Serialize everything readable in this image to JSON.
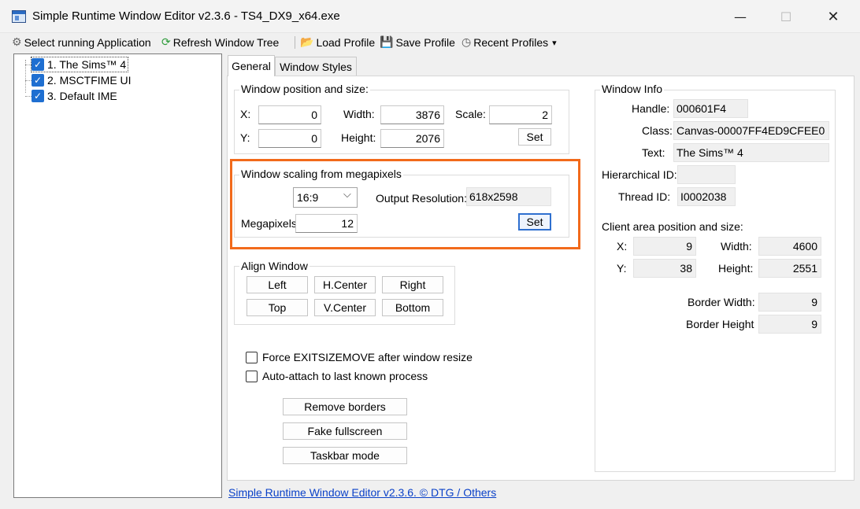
{
  "window": {
    "title": "Simple Runtime Window Editor v2.3.6 - TS4_DX9_x64.exe",
    "minimize": "—",
    "maximize": "☐",
    "close": "✕"
  },
  "toolbar": {
    "select_app": "Select running Application",
    "refresh_tree": "Refresh Window Tree",
    "load_profile": "Load Profile",
    "save_profile": "Save Profile",
    "recent_profiles": "Recent Profiles",
    "recent_arrow": "▾"
  },
  "tree": {
    "items": [
      {
        "label": "1. The Sims™ 4",
        "checked": true
      },
      {
        "label": "2. MSCTFIME UI",
        "checked": true
      },
      {
        "label": "3. Default IME",
        "checked": true
      }
    ],
    "check_glyph": "✓"
  },
  "tabs": {
    "general": "General",
    "window_styles": "Window Styles"
  },
  "position_group": {
    "title": "Window position and size:",
    "x_label": "X:",
    "x_value": "0",
    "y_label": "Y:",
    "y_value": "0",
    "width_label": "Width:",
    "width_value": "3876",
    "height_label": "Height:",
    "height_value": "2076",
    "scale_label": "Scale:",
    "scale_value": "2",
    "set_label": "Set"
  },
  "megapixel_group": {
    "title": "Window scaling from megapixels",
    "aspect_value": "16:9",
    "dropdown_glyph": "⌵",
    "output_label": "Output Resolution:",
    "output_value": "618x2598",
    "megapixels_label": "Megapixels",
    "megapixels_value": "12",
    "set_label": "Set"
  },
  "align_group": {
    "title": "Align Window",
    "left": "Left",
    "hcenter": "H.Center",
    "right": "Right",
    "top": "Top",
    "vcenter": "V.Center",
    "bottom": "Bottom"
  },
  "options": {
    "force_exitsizemove": "Force EXITSIZEMOVE after window resize",
    "auto_attach": "Auto-attach to last known process"
  },
  "actions": {
    "remove_borders": "Remove borders",
    "fake_fullscreen": "Fake fullscreen",
    "taskbar_mode": "Taskbar mode"
  },
  "window_info": {
    "title": "Window Info",
    "handle_label": "Handle:",
    "handle_value": "000601F4",
    "class_label": "Class:",
    "class_value": "Canvas-00007FF4ED9CFEE0",
    "text_label": "Text:",
    "text_value": "The Sims™ 4",
    "hier_label": "Hierarchical ID:",
    "hier_value": "",
    "thread_label": "Thread ID:",
    "thread_value": "I0002038",
    "client_title": "Client area position and size:",
    "cx_label": "X:",
    "cx_value": "9",
    "cy_label": "Y:",
    "cy_value": "38",
    "cwidth_label": "Width:",
    "cwidth_value": "4600",
    "cheight_label": "Height:",
    "cheight_value": "2551",
    "bw_label": "Border Width:",
    "bw_value": "9",
    "bh_label": "Border Height",
    "bh_value": "9"
  },
  "footer": {
    "link": "Simple Runtime Window Editor v2.3.6.  ©  DTG  / Others"
  }
}
